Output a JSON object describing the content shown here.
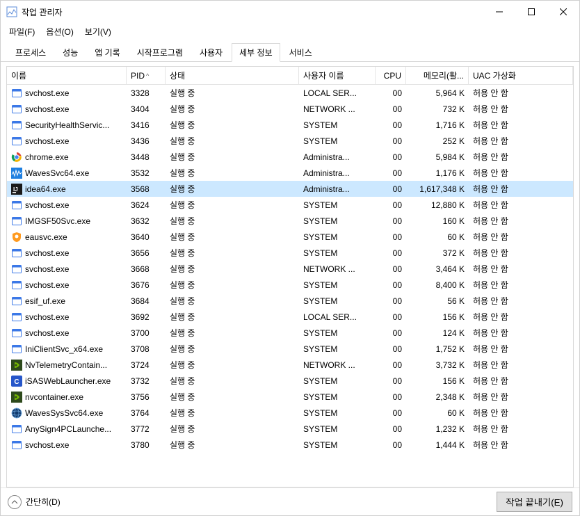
{
  "window": {
    "title": "작업 관리자"
  },
  "menu": {
    "file": "파일(F)",
    "options": "옵션(O)",
    "view": "보기(V)"
  },
  "tabs": {
    "processes": "프로세스",
    "performance": "성능",
    "app_history": "앱 기록",
    "startup": "시작프로그램",
    "users": "사용자",
    "details": "세부 정보",
    "services": "서비스",
    "active": "details"
  },
  "columns": {
    "name": "이름",
    "pid": "PID",
    "status": "상태",
    "user": "사용자 이름",
    "cpu": "CPU",
    "memory": "메모리(활...",
    "uac": "UAC 가상화",
    "sort_indicator": "^"
  },
  "rows": [
    {
      "icon": "svc",
      "name": "svchost.exe",
      "pid": "3328",
      "status": "실행 중",
      "user": "LOCAL SER...",
      "cpu": "00",
      "mem": "5,964 K",
      "uac": "허용 안 함",
      "selected": false
    },
    {
      "icon": "svc",
      "name": "svchost.exe",
      "pid": "3404",
      "status": "실행 중",
      "user": "NETWORK ...",
      "cpu": "00",
      "mem": "732 K",
      "uac": "허용 안 함",
      "selected": false
    },
    {
      "icon": "svc",
      "name": "SecurityHealthServic...",
      "pid": "3416",
      "status": "실행 중",
      "user": "SYSTEM",
      "cpu": "00",
      "mem": "1,716 K",
      "uac": "허용 안 함",
      "selected": false
    },
    {
      "icon": "svc",
      "name": "svchost.exe",
      "pid": "3436",
      "status": "실행 중",
      "user": "SYSTEM",
      "cpu": "00",
      "mem": "252 K",
      "uac": "허용 안 함",
      "selected": false
    },
    {
      "icon": "chrome",
      "name": "chrome.exe",
      "pid": "3448",
      "status": "실행 중",
      "user": "Administra...",
      "cpu": "00",
      "mem": "5,984 K",
      "uac": "허용 안 함",
      "selected": false
    },
    {
      "icon": "waves",
      "name": "WavesSvc64.exe",
      "pid": "3532",
      "status": "실행 중",
      "user": "Administra...",
      "cpu": "00",
      "mem": "1,176 K",
      "uac": "허용 안 함",
      "selected": false
    },
    {
      "icon": "ij",
      "name": "idea64.exe",
      "pid": "3568",
      "status": "실행 중",
      "user": "Administra...",
      "cpu": "00",
      "mem": "1,617,348 K",
      "uac": "허용 안 함",
      "selected": true
    },
    {
      "icon": "svc",
      "name": "svchost.exe",
      "pid": "3624",
      "status": "실행 중",
      "user": "SYSTEM",
      "cpu": "00",
      "mem": "12,880 K",
      "uac": "허용 안 함",
      "selected": false
    },
    {
      "icon": "svc",
      "name": "IMGSF50Svc.exe",
      "pid": "3632",
      "status": "실행 중",
      "user": "SYSTEM",
      "cpu": "00",
      "mem": "160 K",
      "uac": "허용 안 함",
      "selected": false
    },
    {
      "icon": "eau",
      "name": "eausvc.exe",
      "pid": "3640",
      "status": "실행 중",
      "user": "SYSTEM",
      "cpu": "00",
      "mem": "60 K",
      "uac": "허용 안 함",
      "selected": false
    },
    {
      "icon": "svc",
      "name": "svchost.exe",
      "pid": "3656",
      "status": "실행 중",
      "user": "SYSTEM",
      "cpu": "00",
      "mem": "372 K",
      "uac": "허용 안 함",
      "selected": false
    },
    {
      "icon": "svc",
      "name": "svchost.exe",
      "pid": "3668",
      "status": "실행 중",
      "user": "NETWORK ...",
      "cpu": "00",
      "mem": "3,464 K",
      "uac": "허용 안 함",
      "selected": false
    },
    {
      "icon": "svc",
      "name": "svchost.exe",
      "pid": "3676",
      "status": "실행 중",
      "user": "SYSTEM",
      "cpu": "00",
      "mem": "8,400 K",
      "uac": "허용 안 함",
      "selected": false
    },
    {
      "icon": "svc",
      "name": "esif_uf.exe",
      "pid": "3684",
      "status": "실행 중",
      "user": "SYSTEM",
      "cpu": "00",
      "mem": "56 K",
      "uac": "허용 안 함",
      "selected": false
    },
    {
      "icon": "svc",
      "name": "svchost.exe",
      "pid": "3692",
      "status": "실행 중",
      "user": "LOCAL SER...",
      "cpu": "00",
      "mem": "156 K",
      "uac": "허용 안 함",
      "selected": false
    },
    {
      "icon": "svc",
      "name": "svchost.exe",
      "pid": "3700",
      "status": "실행 중",
      "user": "SYSTEM",
      "cpu": "00",
      "mem": "124 K",
      "uac": "허용 안 함",
      "selected": false
    },
    {
      "icon": "svc",
      "name": "IniClientSvc_x64.exe",
      "pid": "3708",
      "status": "실행 중",
      "user": "SYSTEM",
      "cpu": "00",
      "mem": "1,752 K",
      "uac": "허용 안 함",
      "selected": false
    },
    {
      "icon": "nv",
      "name": "NvTelemetryContain...",
      "pid": "3724",
      "status": "실행 중",
      "user": "NETWORK ...",
      "cpu": "00",
      "mem": "3,732 K",
      "uac": "허용 안 함",
      "selected": false
    },
    {
      "icon": "isas",
      "name": "iSASWebLauncher.exe",
      "pid": "3732",
      "status": "실행 중",
      "user": "SYSTEM",
      "cpu": "00",
      "mem": "156 K",
      "uac": "허용 안 함",
      "selected": false
    },
    {
      "icon": "nv",
      "name": "nvcontainer.exe",
      "pid": "3756",
      "status": "실행 중",
      "user": "SYSTEM",
      "cpu": "00",
      "mem": "2,348 K",
      "uac": "허용 안 함",
      "selected": false
    },
    {
      "icon": "wavesys",
      "name": "WavesSysSvc64.exe",
      "pid": "3764",
      "status": "실행 중",
      "user": "SYSTEM",
      "cpu": "00",
      "mem": "60 K",
      "uac": "허용 안 함",
      "selected": false
    },
    {
      "icon": "svc",
      "name": "AnySign4PCLaunche...",
      "pid": "3772",
      "status": "실행 중",
      "user": "SYSTEM",
      "cpu": "00",
      "mem": "1,232 K",
      "uac": "허용 안 함",
      "selected": false
    },
    {
      "icon": "svc",
      "name": "svchost.exe",
      "pid": "3780",
      "status": "실행 중",
      "user": "SYSTEM",
      "cpu": "00",
      "mem": "1,444 K",
      "uac": "허용 안 함",
      "selected": false
    }
  ],
  "footer": {
    "fewer_details": "간단히(D)",
    "end_task": "작업 끝내기(E)"
  },
  "icons": {
    "svc": {
      "type": "app-window",
      "bg": "#ffffff",
      "fg": "#3b78e7"
    },
    "chrome": {
      "type": "chrome"
    },
    "waves": {
      "type": "waves",
      "bg": "#1e7fe0"
    },
    "ij": {
      "type": "ij",
      "bg": "#1a1a1a"
    },
    "eau": {
      "type": "shield",
      "bg": "#ff9a1f"
    },
    "nv": {
      "type": "nvidia",
      "bg": "#2e4a1c"
    },
    "isas": {
      "type": "letter",
      "letter": "C",
      "bg": "#2656c9"
    },
    "wavesys": {
      "type": "globe",
      "bg": "#123b6e"
    }
  }
}
